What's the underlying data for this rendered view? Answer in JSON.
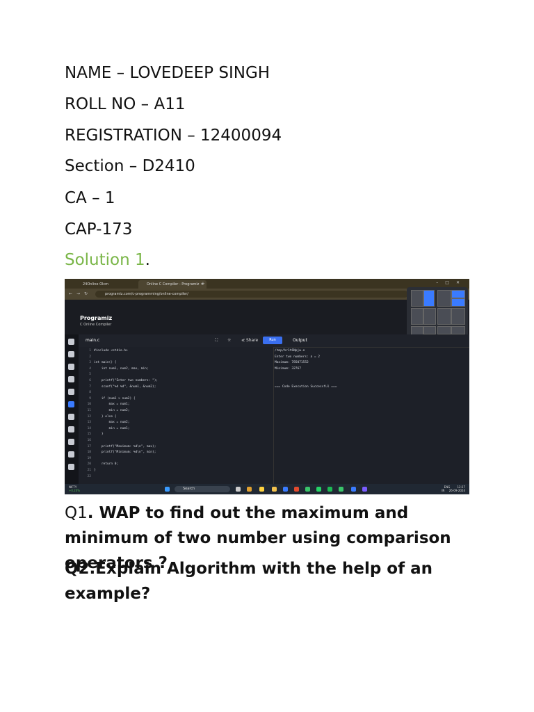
{
  "header": {
    "name": "NAME – LOVEDEEP SINGH",
    "roll": "ROLL NO – A11",
    "registration": "REGISTRATION – 12400094",
    "section": "Section – D2410",
    "ca": "CA – 1",
    "course": "CAP-173"
  },
  "solution": {
    "label": "Solution 1",
    "period": "."
  },
  "screenshot": {
    "tabs": [
      "24Online Olcm",
      "Online C Compiler - Programiz"
    ],
    "url": "programiz.com/c-programming/online-compiler/",
    "brand": "Programiz",
    "brand_sub": "C Online Compiler",
    "file_name": "main.c",
    "share_label": "Share",
    "run_label": "Run",
    "output_label": "Output",
    "code_lines": [
      "#include <stdio.h>",
      "",
      "int main() {",
      "    int num1, num2, max, min;",
      "",
      "    printf(\"Enter two numbers: \");",
      "    scanf(\"%d %d\", &num1, &num2);",
      "",
      "    if (num1 > num2) {",
      "        max = num1;",
      "        min = num2;",
      "    } else {",
      "        max = num2;",
      "        min = num1;",
      "    }",
      "",
      "    printf(\"Maximum: %d\\n\", max);",
      "    printf(\"Minimum: %d\\n\", min);",
      "",
      "    return 0;",
      "}",
      ""
    ],
    "output_lines": [
      "/tmp/hr1t6Npjw.o",
      "Enter two numbers: a = 2",
      "Maximum: 785071552",
      "Minimum: 32767",
      "",
      "",
      "=== Code Execution Successful ==="
    ],
    "taskbar": {
      "ticker": "NIFTY",
      "ticker_change": "+0.20%",
      "search_placeholder": "Search",
      "lang": "ENG",
      "region": "IN",
      "time": "12:27",
      "date": "26-09-2024"
    }
  },
  "questions": {
    "q1_prefix": "Q1",
    "q1_text": ". WAP to find out the maximum and minimum of two number using comparison operators ?",
    "q2_text": "Q2.Explain Algorithm with the help of an example?"
  }
}
